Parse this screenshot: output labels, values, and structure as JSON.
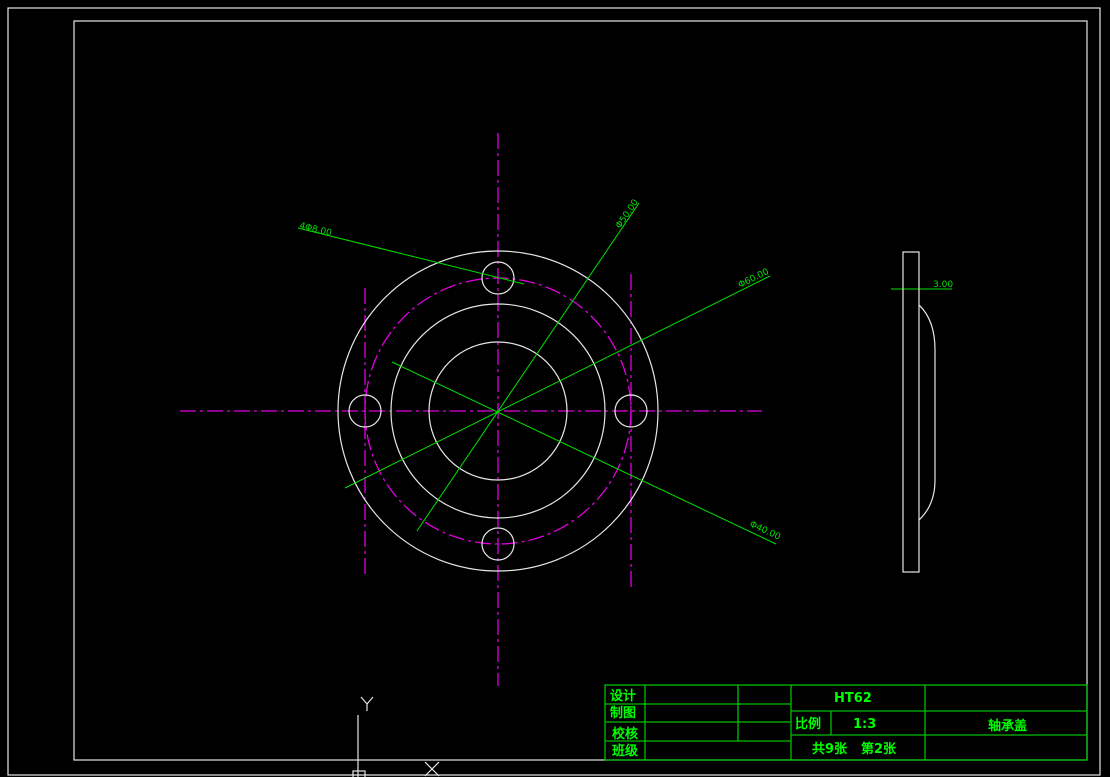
{
  "dimensions": {
    "holes": "4Φ8.00",
    "d50": "Φ50.00",
    "d60": "Φ60.00",
    "d40": "Φ40.00",
    "thickness": "3.00"
  },
  "title_block": {
    "design": "设计",
    "drawing": "制图",
    "check": "校核",
    "class": "班级",
    "material": "HT62",
    "scale_label": "比例",
    "scale_value": "1:3",
    "part_name": "轴承盖",
    "total_sheets": "共9张",
    "sheet_no": "第2张"
  },
  "ucs": {
    "y_label": "Y",
    "x_label": "X"
  }
}
